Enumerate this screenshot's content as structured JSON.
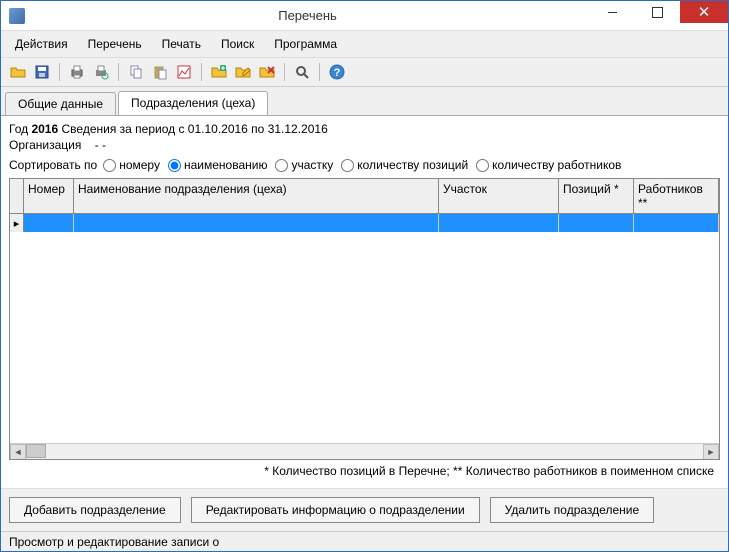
{
  "window": {
    "title": "Перечень"
  },
  "menu": {
    "items": [
      "Действия",
      "Перечень",
      "Печать",
      "Поиск",
      "Программа"
    ]
  },
  "toolbar": {
    "icons": [
      "open-icon",
      "save-icon",
      "print-icon",
      "print-preview-icon",
      "copy-icon",
      "paste-icon",
      "chart-icon",
      "new-folder-icon",
      "edit-folder-icon",
      "delete-icon",
      "find-icon",
      "help-icon"
    ]
  },
  "tabs": {
    "items": [
      "Общие данные",
      "Подразделения (цеха)"
    ],
    "active": 1
  },
  "info": {
    "year_label": "Год",
    "year_value": "2016",
    "period": "Сведения за период с 01.10.2016 по 31.12.2016",
    "org_label": "Организация",
    "org_value": "-   -"
  },
  "sort": {
    "label": "Сортировать по",
    "options": [
      "номеру",
      "наименованию",
      "участку",
      "количеству позиций",
      "количеству работников"
    ],
    "selected": 1
  },
  "grid": {
    "columns": [
      "Номер",
      "Наименование подразделения (цеха)",
      "Участок",
      "Позиций *",
      "Работников **"
    ],
    "rows": [
      {
        "selected": true,
        "cells": [
          "",
          "",
          "",
          "",
          ""
        ]
      }
    ]
  },
  "footnote": "* Количество позиций в Перечне; ** Количество работников в поименном списке",
  "buttons": {
    "add": "Добавить подразделение",
    "edit": "Редактировать информацию о подразделении",
    "delete": "Удалить подразделение"
  },
  "statusbar": "Просмотр и редактирование записи о"
}
